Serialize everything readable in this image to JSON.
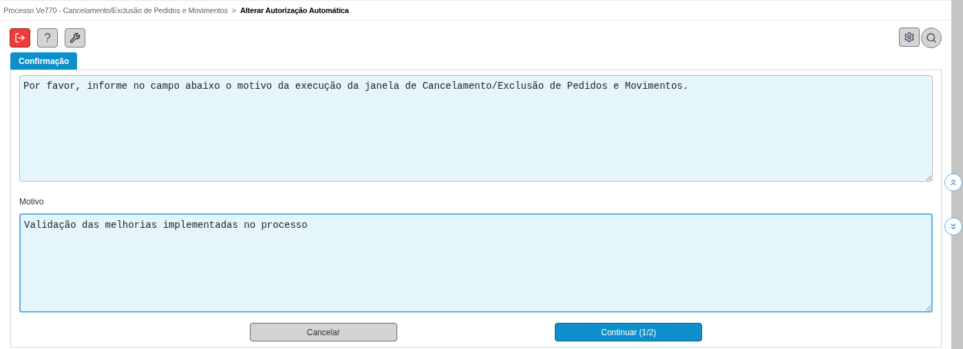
{
  "breadcrumb": {
    "parent": "Processo Ve770 - Cancelamento/Exclusão de Pedidos e Movimentos",
    "separator": ">",
    "current": "Alterar Autorização Automática"
  },
  "toolbar_left": [
    {
      "kind": "exit"
    },
    {
      "kind": "help",
      "label": "?"
    },
    {
      "kind": "tools"
    }
  ],
  "toolbar_right": [
    {
      "kind": "settings"
    },
    {
      "kind": "search"
    }
  ],
  "tabs": [
    {
      "label": "Confirmação",
      "selected": true
    }
  ],
  "message": {
    "value": "Por favor, informe no campo abaixo o motivo da execução da janela de Cancelamento/Exclusão de Pedidos e Movimentos."
  },
  "reason_field": {
    "label": "Motivo",
    "value": "Validação das melhorias implementadas no processo",
    "focused": true
  },
  "buttons": [
    {
      "label": "Cancelar",
      "kind": "secondary"
    },
    {
      "label": "Continuar (1/2)",
      "kind": "primary"
    }
  ]
}
